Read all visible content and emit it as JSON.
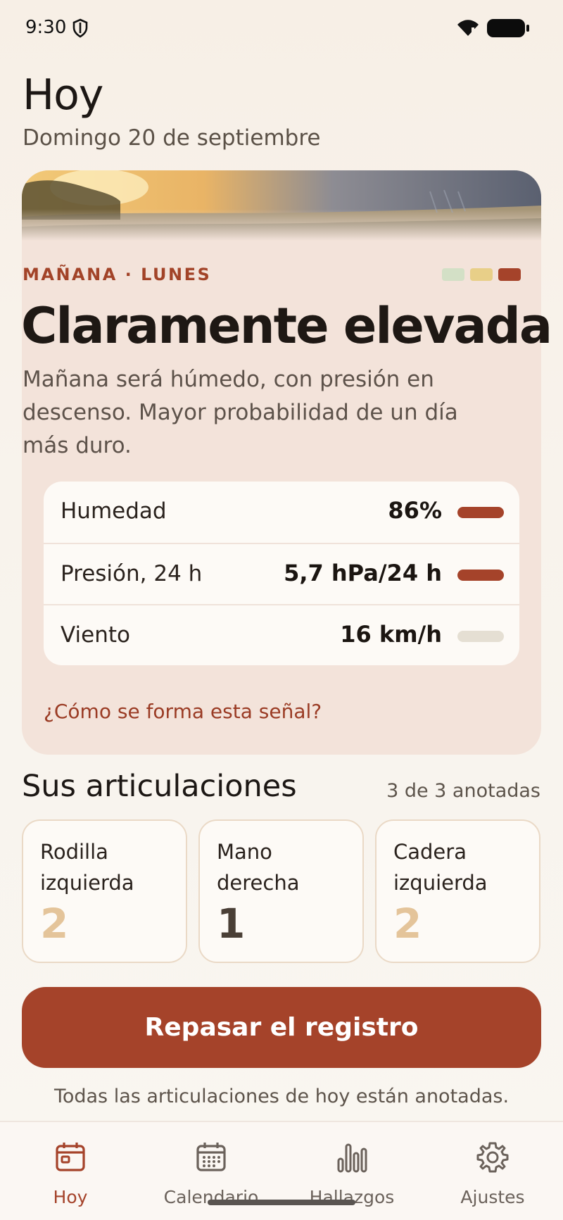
{
  "status_bar": {
    "time": "9:30"
  },
  "header": {
    "title": "Hoy",
    "date": "Domingo 20 de septiembre"
  },
  "forecast": {
    "kicker": "MAÑANA · LUNES",
    "level": "Claramente elevada",
    "description": "Mañana será húmedo, con presión en descenso. Mayor probabilidad de un día más duro.",
    "level_colors": [
      "#d3e0c6",
      "#e8cf88",
      "#a5432a"
    ],
    "metrics": [
      {
        "label": "Humedad",
        "value": "86%",
        "indicator_color": "#a5432a"
      },
      {
        "label": "Presión, 24 h",
        "value": "5,7 hPa/24 h",
        "indicator_color": "#a5432a"
      },
      {
        "label": "Viento",
        "value": "16 km/h",
        "indicator_color": "#e5dfd3"
      }
    ],
    "link": "¿Cómo se forma esta señal?"
  },
  "joints": {
    "title": "Sus articulaciones",
    "count": "3 de 3 anotadas",
    "items": [
      {
        "name": "Rodilla izquierda",
        "score": "2",
        "score_color": "#e4c49a"
      },
      {
        "name": "Mano derecha",
        "score": "1",
        "score_color": "#4a3f36"
      },
      {
        "name": "Cadera izquierda",
        "score": "2",
        "score_color": "#e4c49a"
      }
    ]
  },
  "cta": {
    "label": "Repasar el registro"
  },
  "note": "Todas las articulaciones de hoy están anotadas.",
  "tabbar": {
    "items": [
      {
        "label": "Hoy",
        "icon": "calendar-day-icon",
        "active": true
      },
      {
        "label": "Calendario",
        "icon": "calendar-grid-icon",
        "active": false
      },
      {
        "label": "Hallazgos",
        "icon": "bar-chart-icon",
        "active": false
      },
      {
        "label": "Ajustes",
        "icon": "gear-icon",
        "active": false
      }
    ]
  },
  "colors": {
    "accent": "#a5432a",
    "card_bg": "#f3e3da"
  }
}
